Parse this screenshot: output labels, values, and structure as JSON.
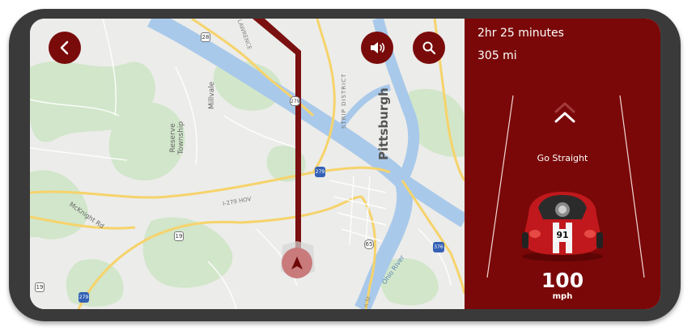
{
  "map": {
    "labels": {
      "pittsburgh": "Pittsburgh",
      "reserve_township": "Reserve\nTownship",
      "millvale": "Millvale",
      "strip_district": "STRIP DISTRICT",
      "mcknight": "McKnight Rd",
      "i279_hov": "I-279 HOV",
      "ohio_river": "Ohio River",
      "lawrence": "LAWRENCE",
      "route_28": "28",
      "route_279a": "279",
      "route_279b": "279",
      "route_19a": "19",
      "route_19b": "19",
      "route_65": "65",
      "route_376": "376",
      "route_279c": "279",
      "st": "n St"
    },
    "route_color": "#7a1010",
    "position_marker_color": "#c98080"
  },
  "nav": {
    "back_icon": "chevron-left-icon",
    "sound_icon": "speaker-icon",
    "search_icon": "search-icon"
  },
  "trip": {
    "time": "2hr 25 minutes",
    "distance": "305 mi"
  },
  "guidance": {
    "instruction": "Go Straight",
    "direction_icon": "chevron-up-icon"
  },
  "car": {
    "number": "91",
    "body_color": "#c0181c"
  },
  "speed": {
    "value": "100",
    "unit": "mph"
  },
  "colors": {
    "accent": "#7a0b0b",
    "panel": "#7a0808",
    "frame": "#3a3a3a"
  }
}
